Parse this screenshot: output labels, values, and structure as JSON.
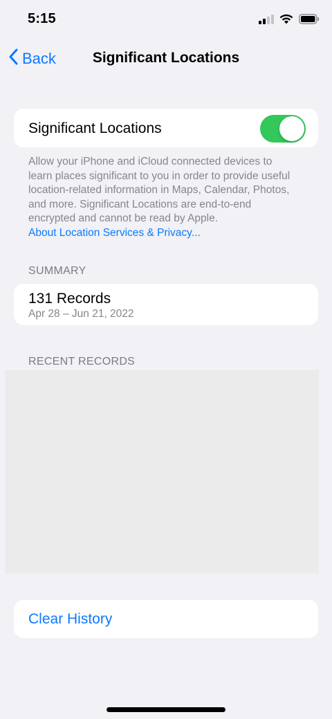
{
  "status_bar": {
    "time": "5:15",
    "icons": [
      "cellular-signal-icon",
      "wifi-icon",
      "battery-icon"
    ]
  },
  "nav": {
    "back_label": "Back",
    "title": "Significant Locations"
  },
  "toggle_row": {
    "label": "Significant Locations",
    "enabled": true,
    "on_color": "#34c759"
  },
  "footnote": {
    "text": "Allow your iPhone and iCloud connected devices to learn places significant to you in order to provide useful location-related information in Maps, Calendar, Photos, and more. Significant Locations are end-to-end encrypted and cannot be read by Apple.",
    "link": "About Location Services & Privacy..."
  },
  "summary": {
    "header": "SUMMARY",
    "title": "131 Records",
    "date_range": "Apr 28 – Jun 21, 2022"
  },
  "recent": {
    "header": "RECENT RECORDS"
  },
  "clear_history_label": "Clear History",
  "colors": {
    "accent": "#0a7aff",
    "background": "#f1f1f6",
    "secondary_text": "#85858b"
  }
}
